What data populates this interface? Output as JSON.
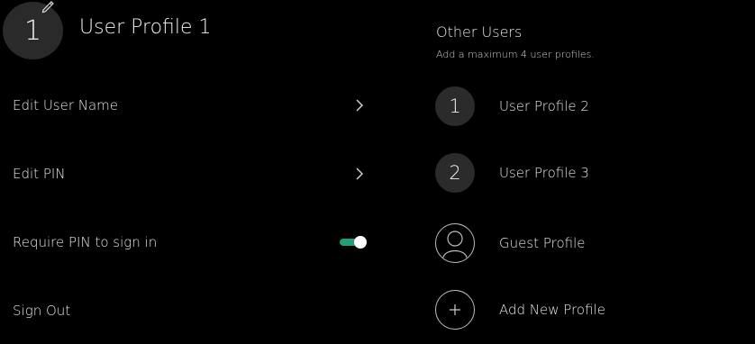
{
  "current_profile": {
    "avatar_label": "1",
    "name": "User Profile 1",
    "edit_icon": "pencil-icon"
  },
  "settings": {
    "items": [
      {
        "label": "Edit User Name",
        "icon": "chevron-right-icon"
      },
      {
        "label": "Edit PIN",
        "icon": "chevron-right-icon"
      },
      {
        "label": "Require PIN to sign in",
        "toggle_on": true
      },
      {
        "label": "Sign Out"
      }
    ]
  },
  "other_users": {
    "title": "Other Users",
    "subtitle": "Add a maximum 4 user profiles.",
    "profiles": [
      {
        "avatar_label": "1",
        "name": "User Profile 2"
      },
      {
        "avatar_label": "2",
        "name": "User Profile 3"
      },
      {
        "icon": "person-icon",
        "name": "Guest Profile"
      },
      {
        "icon": "plus-icon",
        "name": "Add New Profile"
      }
    ]
  },
  "colors": {
    "background": "#000000",
    "toggle_accent": "#1fa07a",
    "avatar_bg": "#2b2b2b"
  }
}
